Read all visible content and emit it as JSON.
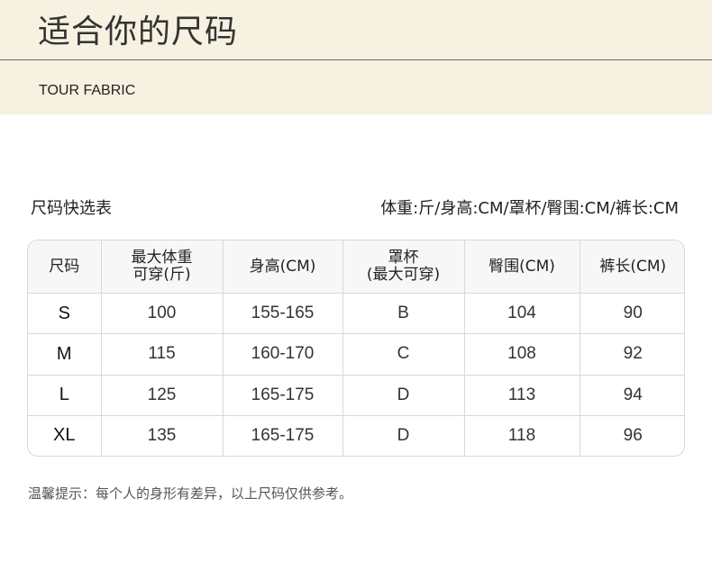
{
  "header": {
    "title": "适合你的尺码",
    "brand": "TOUR FABRIC"
  },
  "table": {
    "caption": "尺码快选表",
    "unit_note": "体重:斤/身高:CM/罩杯/臀围:CM/裤长:CM",
    "columns": [
      {
        "line1": "尺码",
        "line2": ""
      },
      {
        "line1": "最大体重",
        "line2": "可穿(斤)"
      },
      {
        "line1": "身高(CM)",
        "line2": ""
      },
      {
        "line1": "罩杯",
        "line2": "(最大可穿)"
      },
      {
        "line1": "臀围(CM)",
        "line2": ""
      },
      {
        "line1": "裤长(CM)",
        "line2": ""
      }
    ],
    "rows": [
      [
        "S",
        "100",
        "155-165",
        "B",
        "104",
        "90"
      ],
      [
        "M",
        "115",
        "160-170",
        "C",
        "108",
        "92"
      ],
      [
        "L",
        "125",
        "165-175",
        "D",
        "113",
        "94"
      ],
      [
        "XL",
        "135",
        "165-175",
        "D",
        "118",
        "96"
      ]
    ]
  },
  "footnote": "温馨提示：每个人的身形有差异，以上尺码仅供参考。",
  "colors": {
    "header_background": "#f7f1e1",
    "rule": "#6e6a60",
    "table_border": "#d8d8d8",
    "table_header_background": "#f7f7f7"
  }
}
